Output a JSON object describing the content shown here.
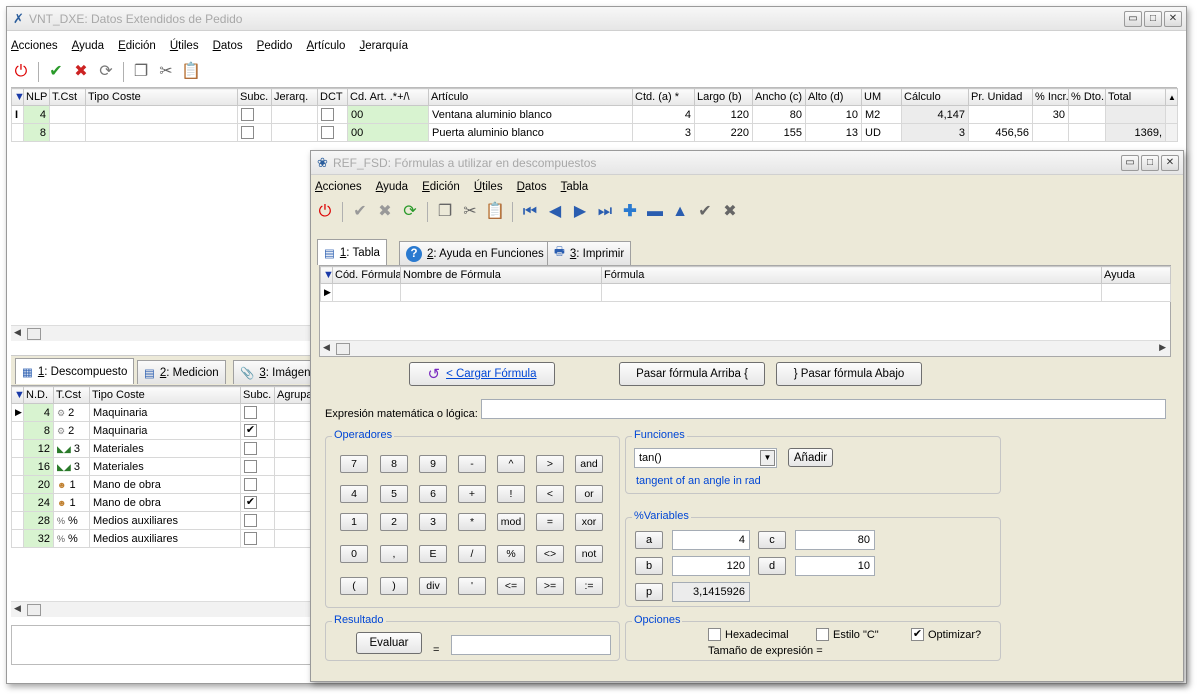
{
  "main": {
    "title": "VNT_DXE: Datos Extendidos de Pedido",
    "menu": [
      "Acciones",
      "Ayuda",
      "Edición",
      "Útiles",
      "Datos",
      "Pedido",
      "Artículo",
      "Jerarquía"
    ],
    "grid": {
      "headers": [
        "NLP",
        "T.Cst",
        "Tipo Coste",
        "Subc.",
        "Jerarq.",
        "DCT",
        "Cd. Art. .*+/\\",
        "Artículo",
        "Ctd. (a) *",
        "Largo (b)",
        "Ancho (c)",
        "Alto (d)",
        "UM",
        "Cálculo",
        "Pr. Unidad",
        "% Incr.",
        "% Dto.",
        "Total"
      ],
      "rows": [
        {
          "nlp": "4",
          "cd_art": "00",
          "articulo": "Ventana aluminio blanco",
          "ctd": "4",
          "largo": "120",
          "ancho": "80",
          "alto": "10",
          "um": "M2",
          "calculo": "4,147",
          "pr_unidad": "",
          "incr": "30",
          "dto": "",
          "total": ""
        },
        {
          "nlp": "8",
          "cd_art": "00",
          "articulo": "Puerta aluminio blanco",
          "ctd": "3",
          "largo": "220",
          "ancho": "155",
          "alto": "13",
          "um": "UD",
          "calculo": "3",
          "pr_unidad": "456,56",
          "incr": "",
          "dto": "",
          "total": "1369,"
        }
      ]
    },
    "tabs": [
      {
        "num": "1",
        "label": ": Descompuesto"
      },
      {
        "num": "2",
        "label": ": Medicion"
      },
      {
        "num": "3",
        "label": ": Imágen"
      }
    ],
    "sub_grid": {
      "headers": [
        "N.D.",
        "T.Cst",
        "Tipo Coste",
        "Subc.",
        "Agrupa"
      ],
      "rows": [
        {
          "nd": "4",
          "tcst": "2",
          "tipo": "Maquinaria",
          "subc": false
        },
        {
          "nd": "8",
          "tcst": "2",
          "tipo": "Maquinaria",
          "subc": true
        },
        {
          "nd": "12",
          "tcst": "3",
          "tipo": "Materiales",
          "subc": false
        },
        {
          "nd": "16",
          "tcst": "3",
          "tipo": "Materiales",
          "subc": false
        },
        {
          "nd": "20",
          "tcst": "1",
          "tipo": "Mano de obra",
          "subc": false
        },
        {
          "nd": "24",
          "tcst": "1",
          "tipo": "Mano de obra",
          "subc": true
        },
        {
          "nd": "28",
          "tcst": "%",
          "tipo": "Medios auxiliares",
          "subc": false
        },
        {
          "nd": "32",
          "tcst": "%",
          "tipo": "Medios auxiliares",
          "subc": false
        }
      ]
    }
  },
  "dialog": {
    "title": "REF_FSD: Fórmulas a utilizar en descompuestos",
    "menu": [
      "Acciones",
      "Ayuda",
      "Edición",
      "Útiles",
      "Datos",
      "Tabla"
    ],
    "tabs": [
      {
        "num": "1",
        "label": ": Tabla"
      },
      {
        "num": "2",
        "label": ": Ayuda en Funciones"
      },
      {
        "num": "3",
        "label": ": Imprimir"
      }
    ],
    "grid_headers": [
      "Cód. Fórmula",
      "Nombre de Fórmula",
      "Fórmula",
      "Ayuda"
    ],
    "btn_cargar": "< Cargar Fórmula",
    "btn_arriba": "Pasar fórmula Arriba {",
    "btn_abajo": "} Pasar fórmula Abajo",
    "expr_label": "Expresión matemática o lógica:",
    "expr_value": "",
    "operadores_label": "Operadores",
    "keys": [
      [
        "7",
        "8",
        "9",
        "-",
        "^",
        ">",
        "and"
      ],
      [
        "4",
        "5",
        "6",
        "+",
        "!",
        "<",
        "or"
      ],
      [
        "1",
        "2",
        "3",
        "*",
        "mod",
        "=",
        "xor"
      ],
      [
        "0",
        ",",
        "E",
        "/",
        "%",
        "<>",
        "not"
      ],
      [
        "(",
        ")",
        "div",
        "'",
        "<=",
        ">=",
        ":="
      ]
    ],
    "funciones_label": "Funciones",
    "func_selected": "tan()",
    "btn_anadir": "Añadir",
    "func_desc": "tangent of an angle in rad",
    "variables_label": "%Variables",
    "vars": {
      "a": "4",
      "b": "120",
      "c": "80",
      "d": "10",
      "p": "3,1415926"
    },
    "resultado_label": "Resultado",
    "btn_evaluar": "Evaluar",
    "eq": "=",
    "result_value": "",
    "opciones_label": "Opciones",
    "opt_hex": "Hexadecimal",
    "opt_c": "Estilo \"C\"",
    "opt_opt": "Optimizar?",
    "opt_hex_checked": false,
    "opt_c_checked": false,
    "opt_opt_checked": true,
    "tamano_label": "Tamaño de expresión ="
  }
}
